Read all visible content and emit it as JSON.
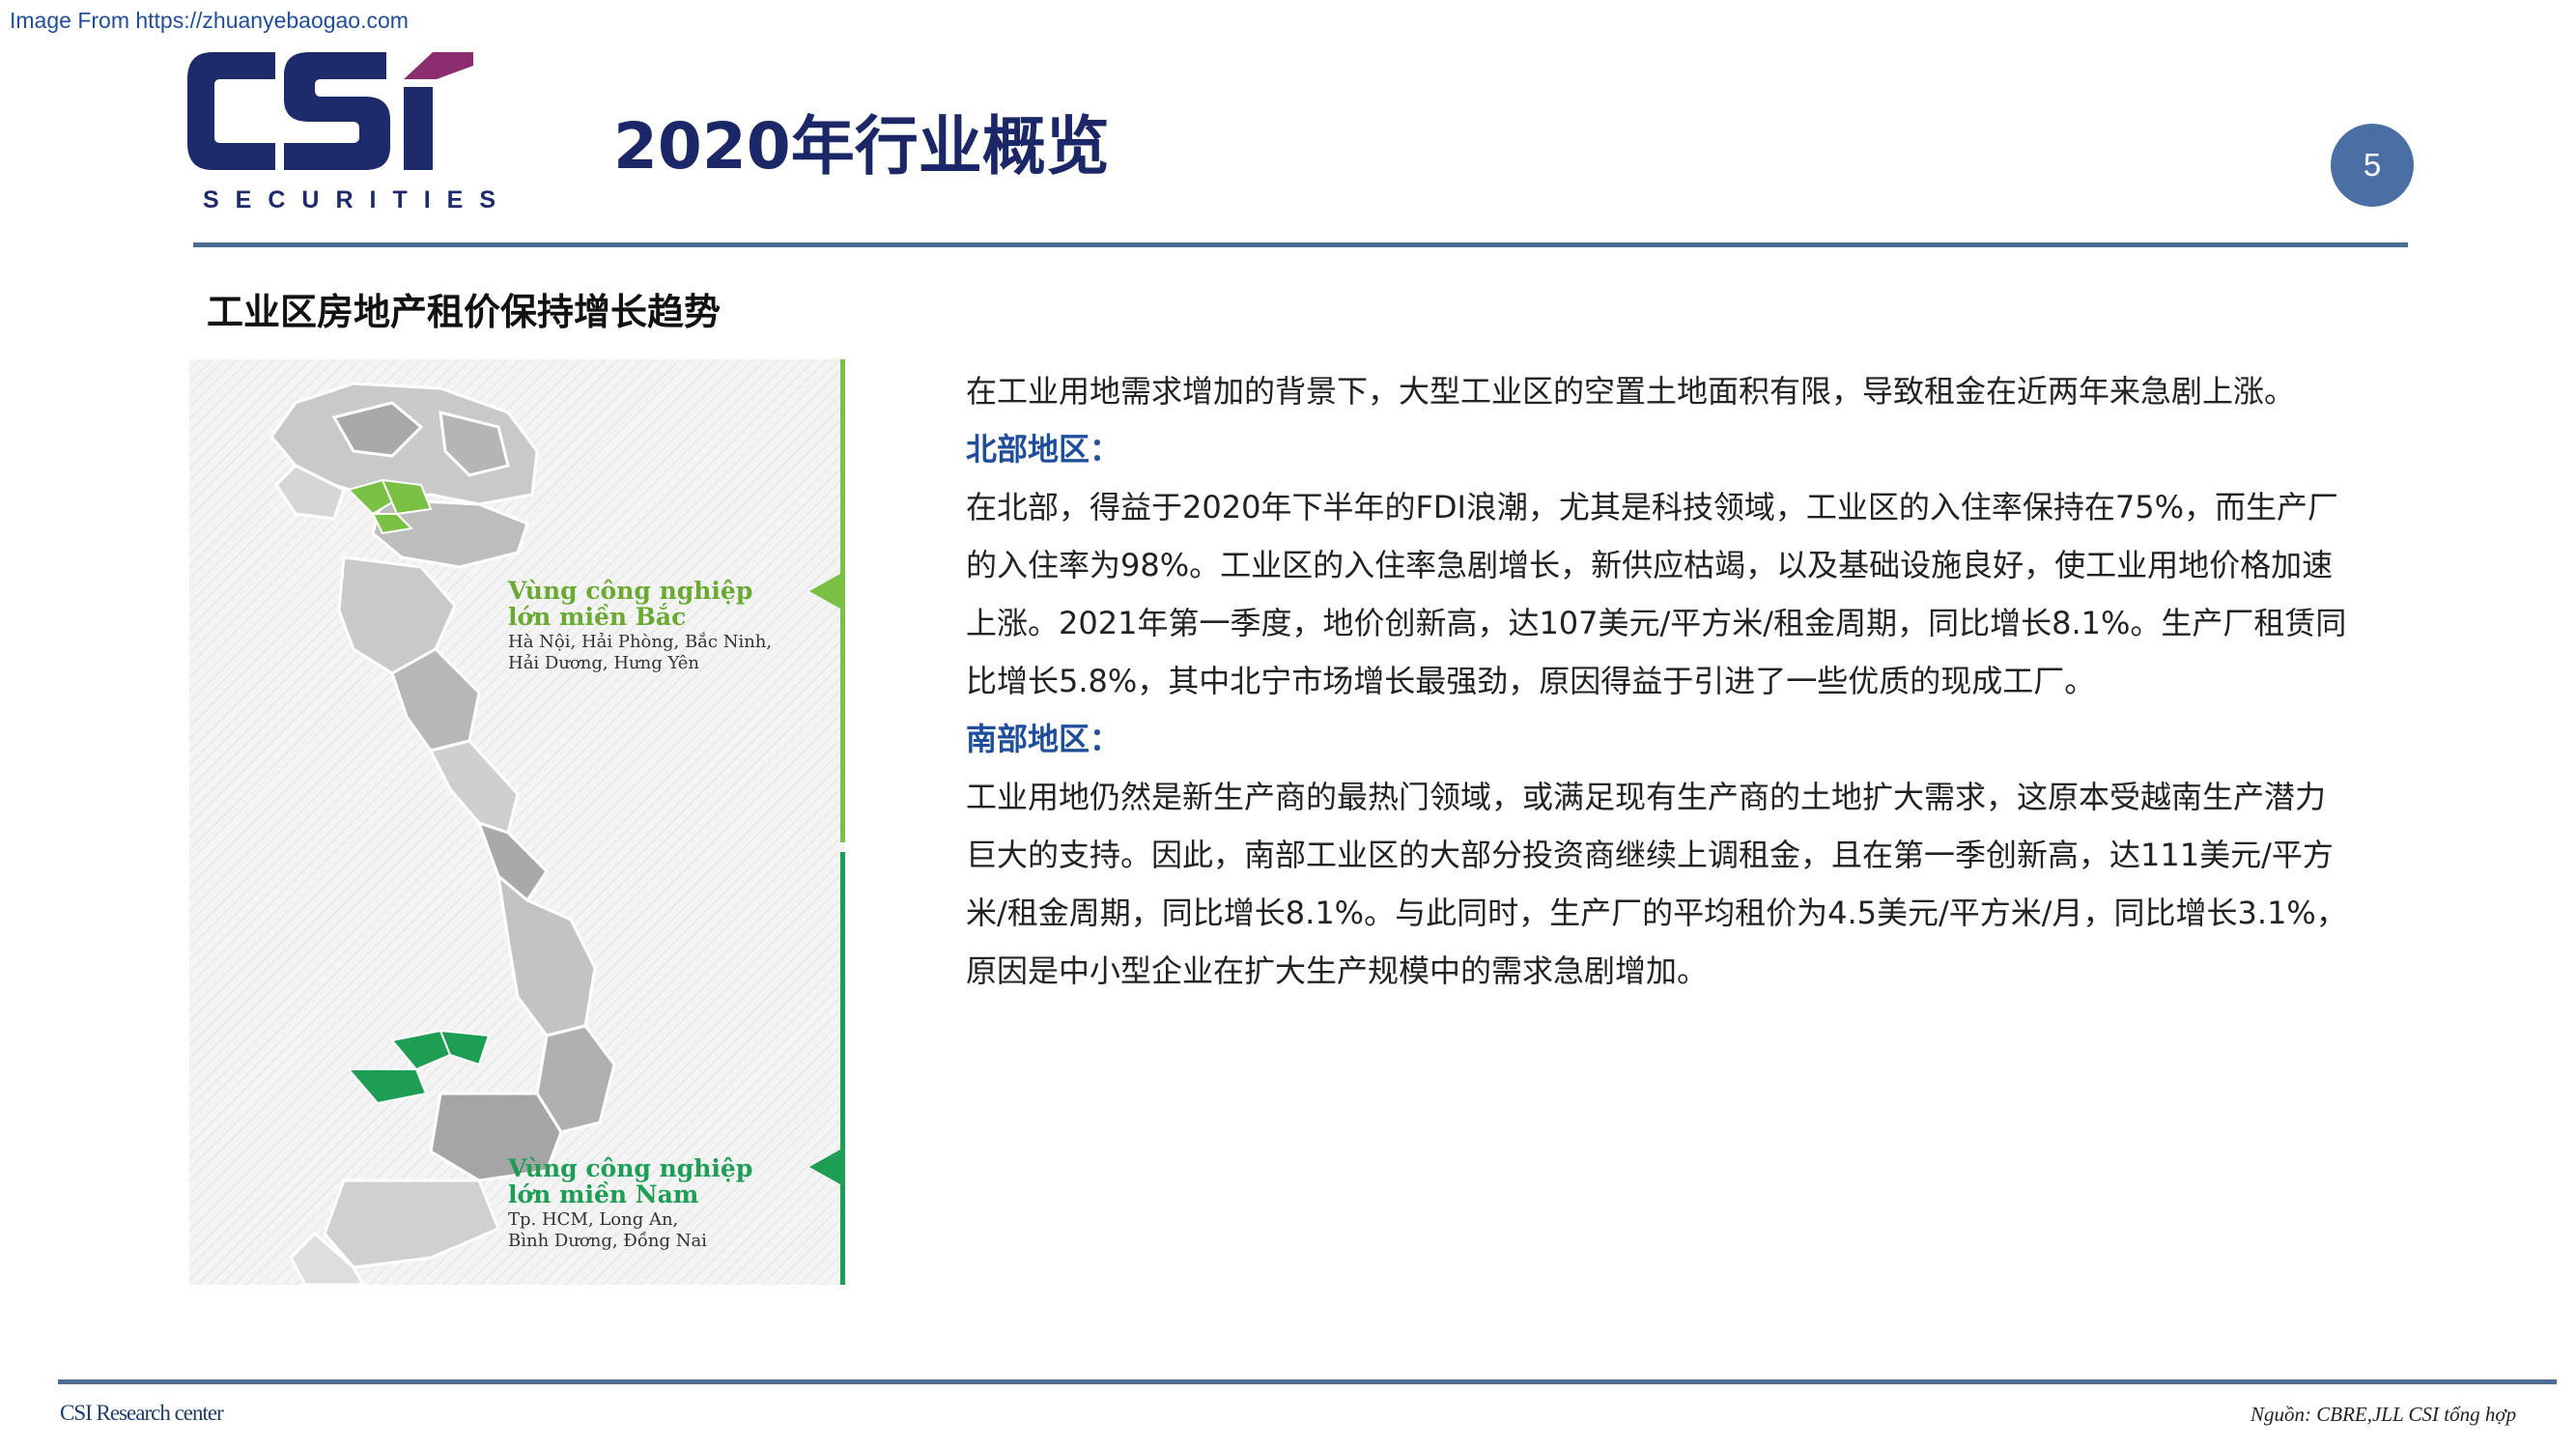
{
  "watermark": "Image From https://zhuanyebaogao.com",
  "logo": {
    "mark": "CSi",
    "subtitle": "SECURITIES",
    "colors": {
      "navy": "#1d2a6b",
      "accent": "#8b2d6e"
    }
  },
  "slide": {
    "title": "2020年行业概览",
    "page_number": "5"
  },
  "section_title": "工业区房地产租价保持增长趋势",
  "map": {
    "north_region": {
      "heading_line1": "Vùng công nghiệp",
      "heading_line2": "lớn miền Bắc",
      "provinces_line1": "Hà Nội, Hải Phòng, Bắc Ninh,",
      "provinces_line2": "Hải Dương, Hưng Yên"
    },
    "south_region": {
      "heading_line1": "Vùng công nghiệp",
      "heading_line2": "lớn miền Nam",
      "provinces_line1": "Tp. HCM, Long An,",
      "provinces_line2": "Bình Dương, Đồng Nai"
    },
    "colors": {
      "north": "#7ac143",
      "south": "#1e9e55",
      "land": "#c7c7c7"
    }
  },
  "body": {
    "intro": "在工业用地需求增加的背景下，大型工业区的空置土地面积有限，导致租金在近两年来急剧上涨。",
    "north_heading": "北部地区：",
    "north_text": "在北部，得益于2020年下半年的FDI浪潮，尤其是科技领域，工业区的入住率保持在75%，而生产厂的入住率为98%。工业区的入住率急剧增长，新供应枯竭，以及基础设施良好，使工业用地价格加速上涨。2021年第一季度，地价创新高，达107美元/平方米/租金周期，同比增长8.1%。生产厂租赁同比增长5.8%，其中北宁市场增长最强劲，原因得益于引进了一些优质的现成工厂。",
    "south_heading": "南部地区：",
    "south_text": "工业用地仍然是新生产商的最热门领域，或满足现有生产商的土地扩大需求，这原本受越南生产潜力巨大的支持。因此，南部工业区的大部分投资商继续上调租金，且在第一季创新高，达111美元/平方米/租金周期，同比增长8.1%。与此同时，生产厂的平均租价为4.5美元/平方米/月，同比增长3.1%，原因是中小型企业在扩大生产规模中的需求急剧增加。"
  },
  "footer": {
    "left": "CSI Research center",
    "right": "Nguồn: CBRE,JLL CSI tổng hợp"
  }
}
